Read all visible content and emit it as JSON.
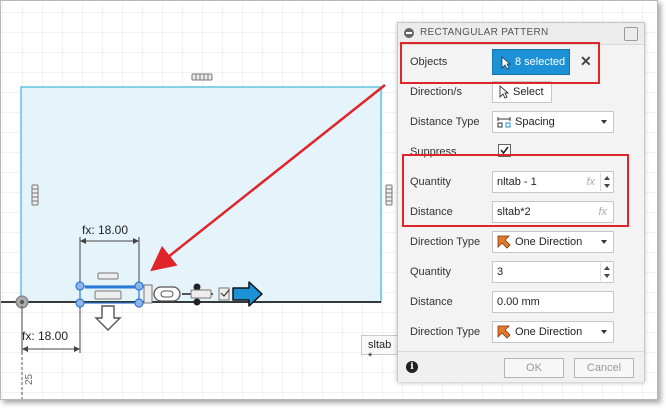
{
  "dialog": {
    "title": "RECTANGULAR PATTERN",
    "rows": {
      "objects_label": "Objects",
      "objects_value": "8 selected",
      "objects_clear": "✕",
      "direction_label": "Direction/s",
      "direction_value": "Select",
      "distance_type_label": "Distance Type",
      "distance_type_value": "Spacing",
      "suppress_label": "Suppress",
      "quantity1_label": "Quantity",
      "quantity1_value": "nltab - 1",
      "distance1_label": "Distance",
      "distance1_value": "sltab*2",
      "direction_type1_label": "Direction Type",
      "direction_type1_value": "One Direction",
      "quantity2_label": "Quantity",
      "quantity2_value": "3",
      "distance2_label": "Distance",
      "distance2_value": "0.00 mm",
      "direction_type2_label": "Direction Type",
      "direction_type2_value": "One Direction"
    },
    "fx_symbol": "fx",
    "ok_label": "OK",
    "cancel_label": "Cancel",
    "info_symbol": "i"
  },
  "canvas": {
    "dim_top": "fx: 18.00",
    "dim_bottom": "fx: 18.00",
    "tooltip": "sltab *",
    "corner_text": "25"
  },
  "colors": {
    "accent": "#1d91d6",
    "highlight_red": "#e0252a",
    "sketch_fill": "#e5f3fb",
    "sketch_edge": "#62c2dd"
  },
  "icons": [
    "cursor-icon",
    "close-icon",
    "spacing-icon",
    "checkbox-icon",
    "direction-icon",
    "info-icon",
    "settings-icon"
  ]
}
